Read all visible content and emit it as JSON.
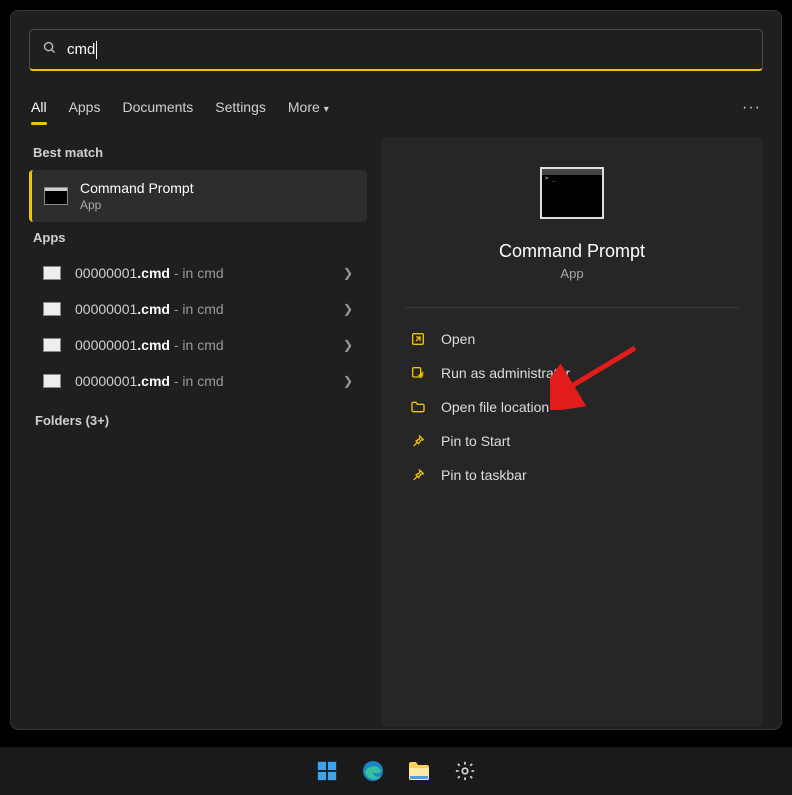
{
  "search": {
    "query": "cmd"
  },
  "tabs": {
    "items": [
      "All",
      "Apps",
      "Documents",
      "Settings",
      "More"
    ],
    "active": "All"
  },
  "left": {
    "best_match_label": "Best match",
    "best_match": {
      "title": "Command Prompt",
      "subtitle": "App"
    },
    "apps_label": "Apps",
    "apps": [
      {
        "name": "00000001",
        "ext": ".cmd",
        "suffix": " - in cmd"
      },
      {
        "name": "00000001",
        "ext": ".cmd",
        "suffix": " - in cmd"
      },
      {
        "name": "00000001",
        "ext": ".cmd",
        "suffix": " - in cmd"
      },
      {
        "name": "00000001",
        "ext": ".cmd",
        "suffix": " - in cmd"
      }
    ],
    "folders_label": "Folders (3+)"
  },
  "preview": {
    "title": "Command Prompt",
    "subtitle": "App",
    "actions": [
      {
        "icon": "open",
        "label": "Open"
      },
      {
        "icon": "admin",
        "label": "Run as administrator"
      },
      {
        "icon": "folder",
        "label": "Open file location"
      },
      {
        "icon": "pin",
        "label": "Pin to Start"
      },
      {
        "icon": "pin",
        "label": "Pin to taskbar"
      }
    ]
  }
}
